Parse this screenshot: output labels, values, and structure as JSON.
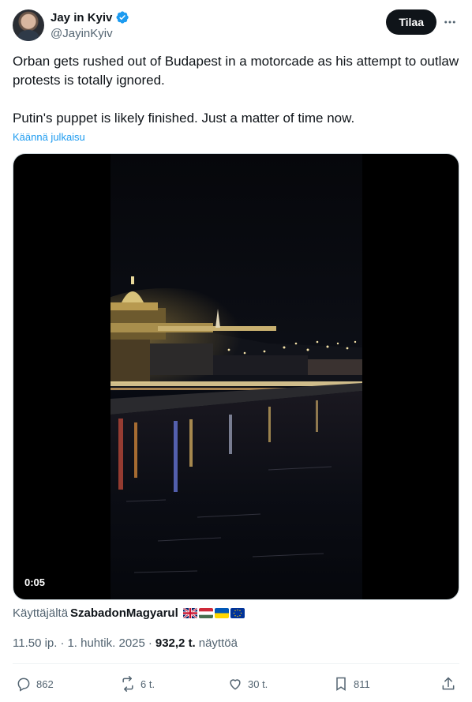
{
  "author": {
    "display_name": "Jay in Kyiv",
    "handle": "@JayinKyiv",
    "verified": true
  },
  "header": {
    "subscribe_label": "Tilaa",
    "more_icon": "more-horizontal-icon"
  },
  "tweet": {
    "paragraphs": [
      "Orban gets rushed out of Budapest in a motorcade as his attempt to outlaw protests is totally ignored.",
      "Putin's puppet is likely finished. Just a matter of time now."
    ],
    "translate_label": "Käännä julkaisu"
  },
  "media": {
    "duration": "0:05"
  },
  "source": {
    "prefix": "Käyttäjältä",
    "name": "SzabadonMagyarul",
    "flags": [
      "uk-flag-icon",
      "hungary-flag-icon",
      "ukraine-flag-icon",
      "eu-flag-icon"
    ]
  },
  "meta": {
    "time": "11.50 ip.",
    "separator1": "·",
    "date": "1. huhtik. 2025",
    "separator2": "·",
    "views_count": "932,2 t.",
    "views_label": "näyttöä"
  },
  "actions": {
    "replies": "862",
    "reposts": "6 t.",
    "likes": "30 t.",
    "bookmarks": "811"
  },
  "colors": {
    "accent": "#1d9bf0",
    "text": "#0f1419",
    "secondary": "#536471"
  }
}
